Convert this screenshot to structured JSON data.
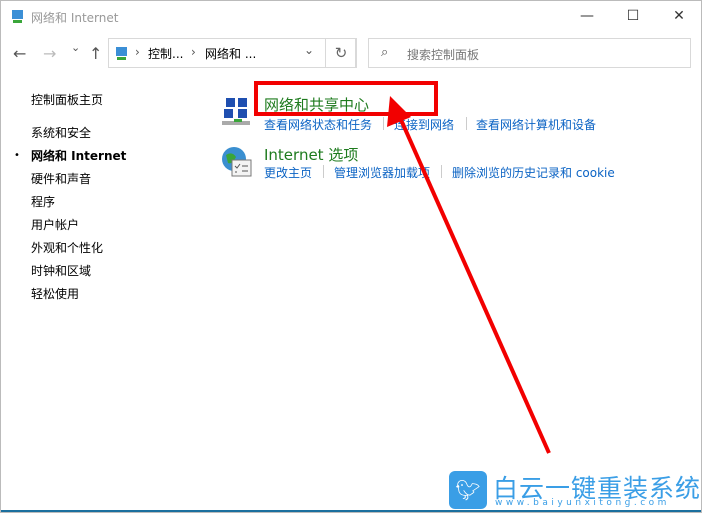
{
  "window": {
    "title": "网络和 Internet",
    "minimize": "—",
    "maximize": "☐",
    "close": "✕"
  },
  "nav": {
    "back": "←",
    "forward": "→",
    "recent": "⌄",
    "up": "↑",
    "refresh": "↻",
    "breadcrumb": [
      "控制...",
      "网络和 ..."
    ],
    "sep": "›",
    "dropdown": "⌄"
  },
  "search": {
    "placeholder": "搜索控制面板",
    "icon": "search-icon"
  },
  "sidebar": {
    "home": "控制面板主页",
    "items": [
      "系统和安全",
      "网络和 Internet",
      "硬件和声音",
      "程序",
      "用户帐户",
      "外观和个性化",
      "时钟和区域",
      "轻松使用"
    ],
    "active_index": 1,
    "bullet": "•"
  },
  "categories": [
    {
      "title": "网络和共享中心",
      "links": [
        "查看网络状态和任务",
        "连接到网络",
        "查看网络计算机和设备"
      ]
    },
    {
      "title": "Internet 选项",
      "links": [
        "更改主页",
        "管理浏览器加载项",
        "删除浏览的历史记录和 cookie"
      ]
    }
  ],
  "annotation": {
    "color": "#f20000"
  },
  "watermark": {
    "title": "白云一键重装系统",
    "url": "www.baiyunxitong.com",
    "color": "#3a9ee6"
  }
}
